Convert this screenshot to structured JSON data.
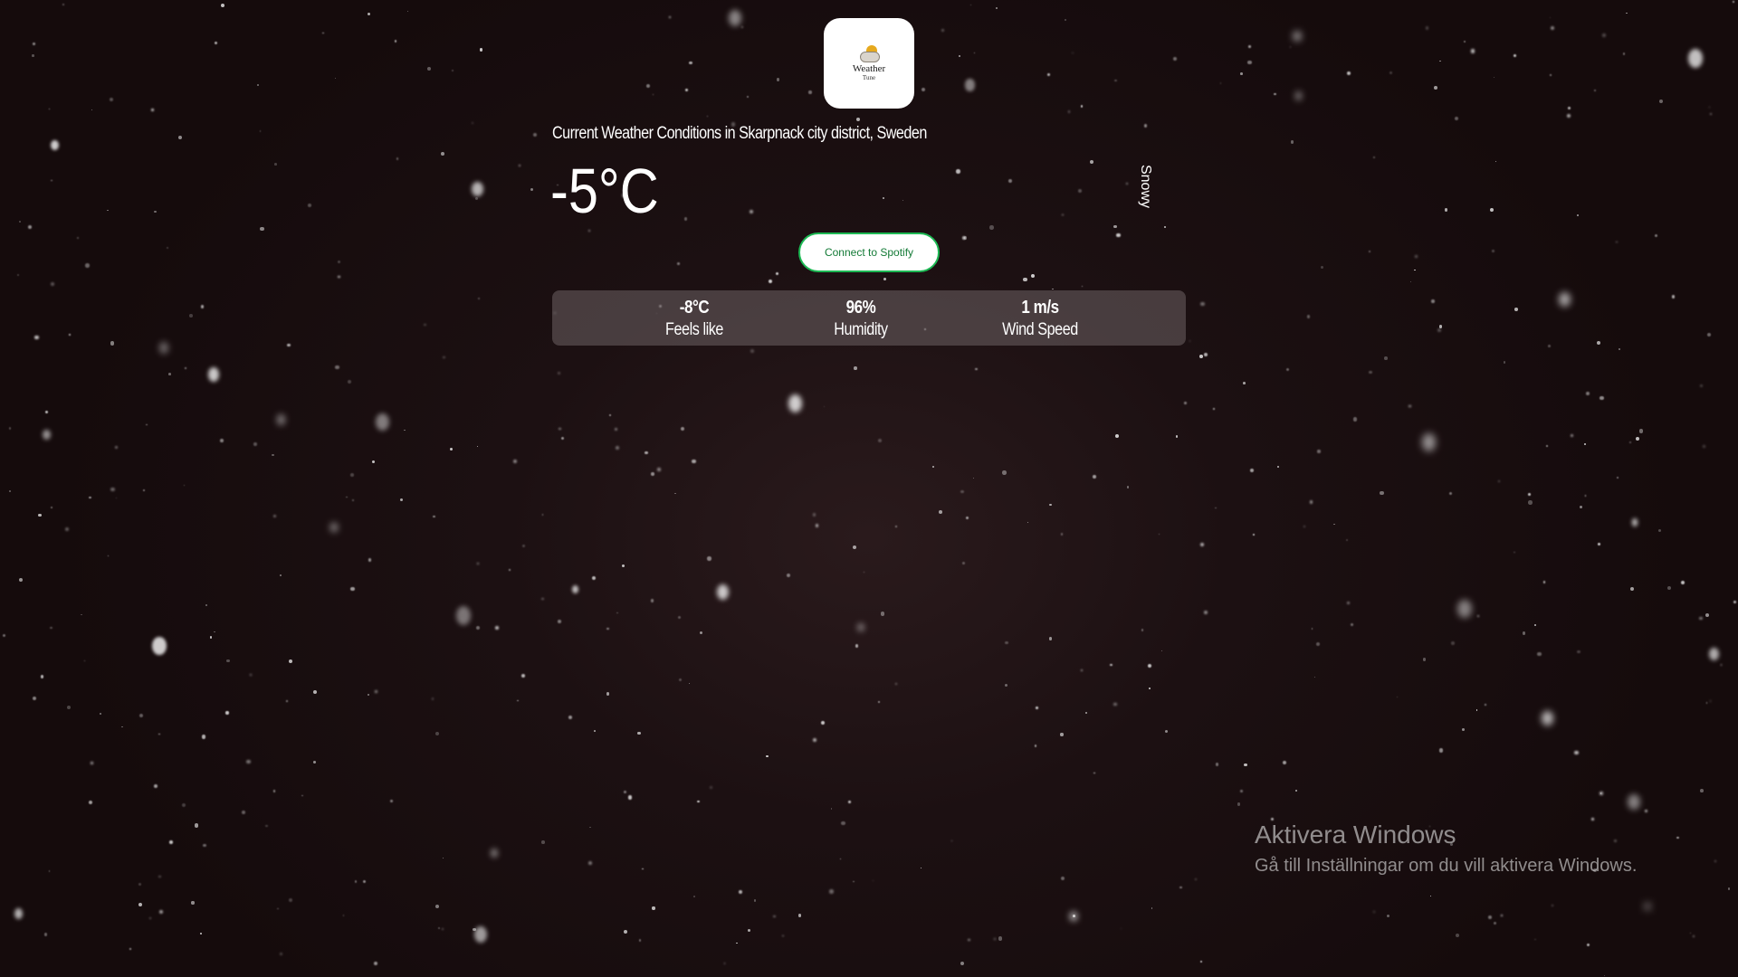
{
  "app": {
    "logo_title": "Weather",
    "logo_subtitle": "Tune",
    "logo_icon": "sun-cloud-icon"
  },
  "weather": {
    "location_title": "Current Weather Conditions in Skarpnack city district, Sweden",
    "temperature": "-5°C",
    "condition": "Snowy"
  },
  "spotify": {
    "button_label": "Connect to Spotify",
    "accent_color": "#1db954"
  },
  "stats": {
    "feels_like_value": "-8°C",
    "feels_like_label": "Feels like",
    "humidity_value": "96%",
    "humidity_label": "Humidity",
    "wind_value": "1 m/s",
    "wind_label": "Wind Speed"
  },
  "watermark": {
    "title": "Aktivera Windows",
    "subtitle": "Gå till Inställningar om du vill aktivera Windows."
  },
  "colors": {
    "background": "#1c1012",
    "panel": "#6e6264"
  }
}
